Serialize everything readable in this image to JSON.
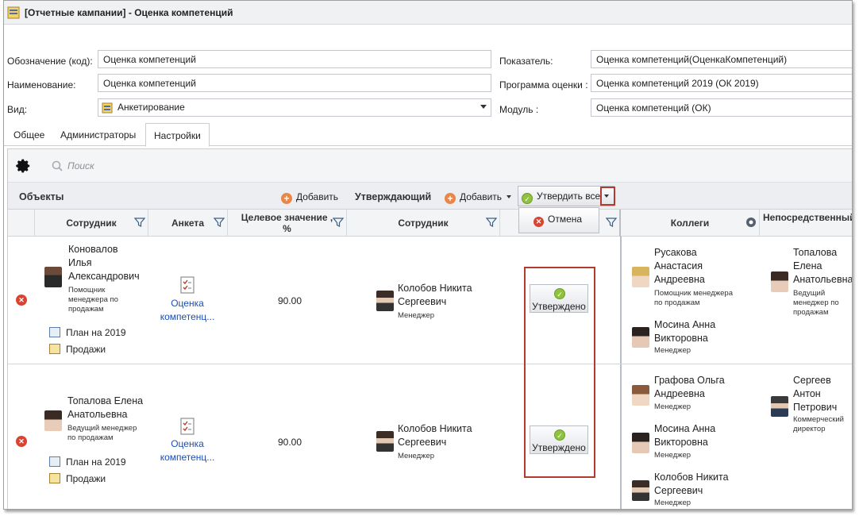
{
  "window": {
    "title": "[Отчетные кампании] - Оценка компетенций"
  },
  "form": {
    "code_label": "Обозначение (код):",
    "code_value": "Оценка компетенций",
    "name_label": "Наименование:",
    "name_value": "Оценка компетенций",
    "type_label": "Вид:",
    "type_value": "Анкетирование",
    "indicator_label": "Показатель:",
    "indicator_value": "Оценка компетенций(ОценкаКомпетенций)",
    "program_label": "Программа оценки :",
    "program_value": "Оценка компетенций 2019 (ОК 2019)",
    "module_label": "Модуль :",
    "module_value": "Оценка компетенций (ОК)"
  },
  "tabs": [
    {
      "label": "Общее",
      "active": false
    },
    {
      "label": "Администраторы",
      "active": false
    },
    {
      "label": "Настройки",
      "active": true
    }
  ],
  "toolbar": {
    "search_placeholder": "Поиск",
    "gear_icon": "gear-icon",
    "search_icon": "search-icon"
  },
  "groups": {
    "objects_title": "Объекты",
    "objects_add": "Добавить",
    "approver_title": "Утверждающий",
    "approver_add": "Добавить",
    "approve_all": "Утвердить все"
  },
  "columns": {
    "employee": "Сотрудник",
    "form": "Анкета",
    "target": "Целевое значение ,\n%",
    "approver_employee": "Сотрудник",
    "cancel": "Отмена",
    "colleagues": "Коллеги",
    "manager": "Непосредственный руководитель"
  },
  "rows": [
    {
      "employee_name": "Коновалов\nИлья\nАлександрович",
      "employee_role": "Помощник\nменеджера по\nпродажам",
      "plan": "План на 2019",
      "sales": "Продажи",
      "form_link": "Оценка\nкомпетенц...",
      "target": "90.00",
      "approver_name": "Колобов Никита\nСергеевич",
      "approver_role": "Менеджер",
      "status": "Утверждено",
      "colleagues": [
        {
          "name": "Русакова\nАнастасия\nАндреевна",
          "role": "Помощник менеджера\nпо продажам"
        },
        {
          "name": "Мосина Анна\nВикторовна",
          "role": "Менеджер"
        }
      ],
      "manager": {
        "name": "Топалова\nЕлена\nАнатольевна",
        "role": "Ведущий\nменеджер по\nпродажам"
      }
    },
    {
      "employee_name": "Топалова Елена\nАнатольевна",
      "employee_role": "Ведущий менеджер\nпо продажам",
      "plan": "План на 2019",
      "sales": "Продажи",
      "form_link": "Оценка\nкомпетенц...",
      "target": "90.00",
      "approver_name": "Колобов Никита\nСергеевич",
      "approver_role": "Менеджер",
      "status": "Утверждено",
      "colleagues": [
        {
          "name": "Графова Ольга\nАндреевна",
          "role": "Менеджер"
        },
        {
          "name": "Мосина Анна\nВикторовна",
          "role": "Менеджер"
        },
        {
          "name": "Колобов Никита\nСергеевич",
          "role": "Менеджер"
        }
      ],
      "manager": {
        "name": "Сергеев\nАнтон\nПетрович",
        "role": "Коммерческий\nдиректор"
      }
    }
  ],
  "colors": {
    "accent_red": "#b23a2f",
    "ok_green": "#8fc33f",
    "add_orange": "#e9874a",
    "link_blue": "#1a4fb8"
  }
}
